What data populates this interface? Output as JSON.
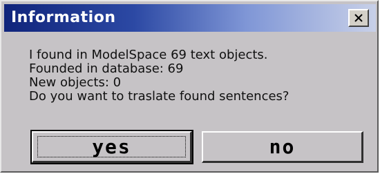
{
  "window": {
    "title": "Information",
    "close_icon": "close-icon"
  },
  "message": {
    "lines": [
      "I found in ModelSpace 69 text objects.",
      "Founded in database: 69",
      "New objects: 0",
      "Do you want to traslate found sentences?"
    ]
  },
  "buttons": {
    "yes_label": "yes",
    "no_label": "no"
  },
  "colors": {
    "title_bar_start": "#10247b",
    "dialog_face": "#c6c3c6",
    "title_text": "#ffffff"
  }
}
